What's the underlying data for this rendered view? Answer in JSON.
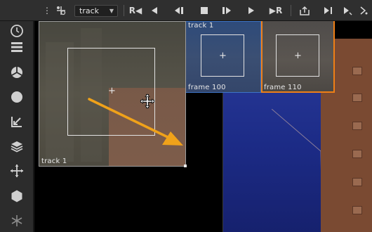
{
  "toolbar": {
    "mode_select": {
      "value": "track"
    },
    "buttons": [
      {
        "icon": "reference-frame-icon",
        "glyph": "⟐"
      },
      {
        "icon": "track-backward-icon",
        "glyph": "R◀"
      },
      {
        "icon": "step-back-icon",
        "glyph": "◀"
      },
      {
        "icon": "step-back-keyframe-icon",
        "glyph": "◀▌"
      },
      {
        "icon": "stop-icon",
        "glyph": "■"
      },
      {
        "icon": "step-forward-keyframe-icon",
        "glyph": "▌▶"
      },
      {
        "icon": "step-forward-icon",
        "glyph": "▶"
      },
      {
        "icon": "track-forward-icon",
        "glyph": "▶R"
      },
      {
        "icon": "export-icon",
        "glyph": "⇪"
      },
      {
        "icon": "play-range-icon",
        "glyph": "▶▌"
      },
      {
        "icon": "keyframe-icon",
        "glyph": "▶"
      },
      {
        "icon": "settings-icon",
        "glyph": "▸"
      }
    ]
  },
  "sidebar": {
    "tools": [
      {
        "icon": "clock-icon"
      },
      {
        "icon": "menu-icon"
      },
      {
        "icon": "radial-icon"
      },
      {
        "icon": "circle-icon"
      },
      {
        "icon": "transform-corner-icon"
      },
      {
        "icon": "layers-icon"
      },
      {
        "icon": "move-icon"
      },
      {
        "icon": "hexagon-icon"
      },
      {
        "icon": "asterisk-icon"
      }
    ]
  },
  "viewer": {
    "main_track_label": "track 1",
    "thumbnails": [
      {
        "top_label": "track 1",
        "bottom_label": "frame 100",
        "highlight_color": "#3d74c6"
      },
      {
        "top_label": "",
        "bottom_label": "frame 110",
        "highlight_color": "#ef7f16"
      }
    ],
    "arrow_color": "#f0a21a"
  }
}
